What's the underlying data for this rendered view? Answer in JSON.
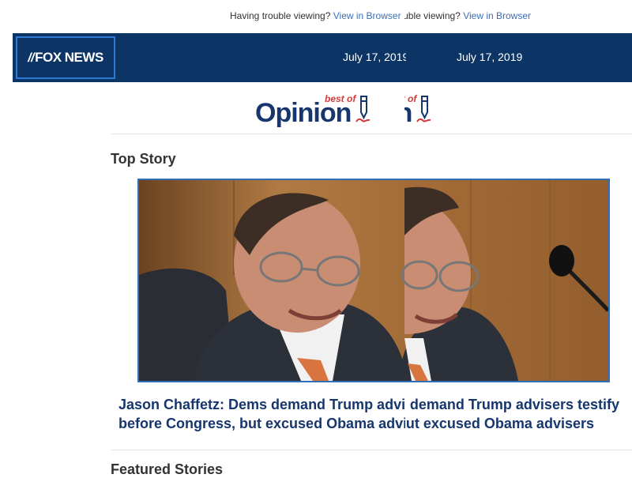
{
  "top_bar": {
    "trouble_text": "Having trouble viewing?",
    "view_link": "View in Browser"
  },
  "header": {
    "logo": "FOX NEWS",
    "date": "July 17, 2019"
  },
  "banner": {
    "best_of": "best of",
    "opinion": "Opinion"
  },
  "sections": {
    "top_story": "Top Story",
    "featured": "Featured Stories"
  },
  "top_story": {
    "headline_line1": "Jason Chaffetz: Dems demand Trump advisers testify",
    "headline_line2": "before Congress, but excused Obama advisers"
  },
  "colors": {
    "header_bg": "#0c3566",
    "link": "#3d6fb6",
    "headline": "#16366d",
    "accent_border": "#2f6fb7",
    "best_of_red": "#d33b3b"
  }
}
